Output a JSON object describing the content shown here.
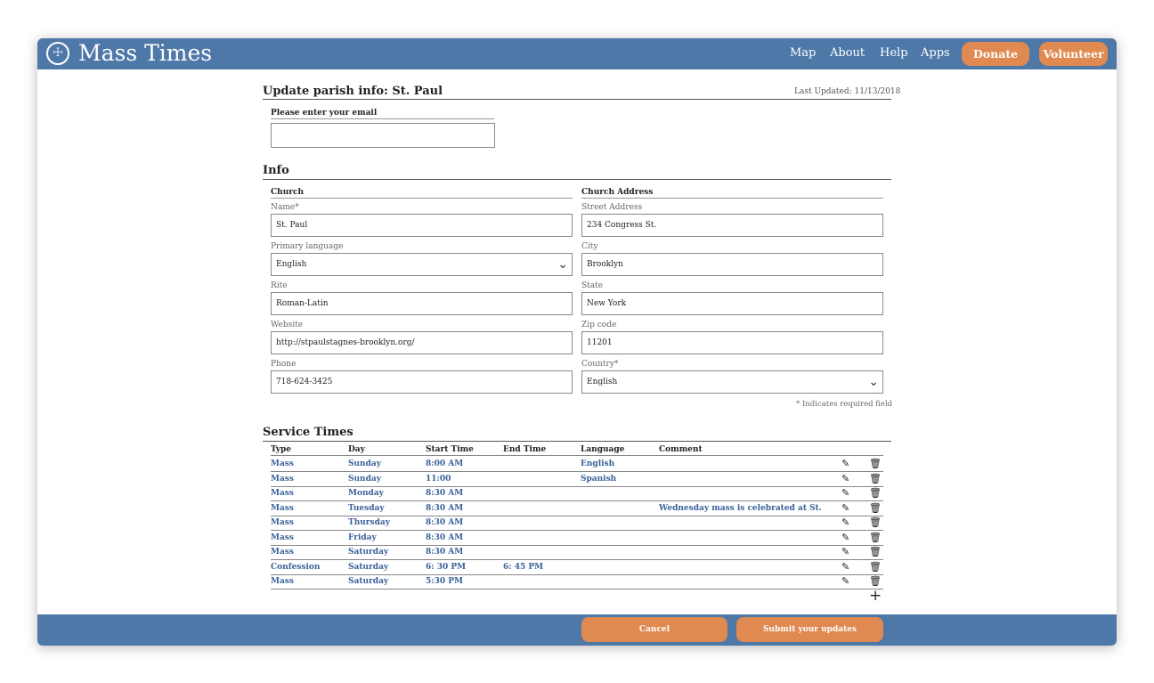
{
  "app": {
    "brand": "Mass Times",
    "logo_glyph": "☩",
    "nav": [
      "Map",
      "About",
      "Help",
      "Apps"
    ],
    "donate_label": "Donate",
    "volunteer_label": "Volunteer"
  },
  "page": {
    "title": "Update parish info: St. Paul",
    "last_updated": "Last Updated:  11/13/2018",
    "email_label": "Please enter your email",
    "email_value": ""
  },
  "info": {
    "heading": "Info",
    "church_heading": "Church",
    "address_heading": "Church Address",
    "name_label": "Name*",
    "name_value": "St. Paul",
    "language_label": "Primary language",
    "language_value": "English",
    "rite_label": "Rite",
    "rite_value": "Roman-Latin",
    "website_label": "Website",
    "website_value": "http://stpaulstagnes-brooklyn.org/",
    "phone_label": "Phone",
    "phone_value": "718-624-3425",
    "street_label": "Street Address",
    "street_value": "234 Congress St.",
    "city_label": "City",
    "city_value": "Brooklyn",
    "state_label": "State",
    "state_value": "New York",
    "zip_label": "Zip code",
    "zip_value": "11201",
    "country_label": "Country*",
    "country_value": "English",
    "required_note": "* Indicates required field"
  },
  "services": {
    "heading": "Service Times",
    "columns": [
      "Type",
      "Day",
      "Start Time",
      "End Time",
      "Language",
      "Comment"
    ],
    "rows": [
      {
        "type": "Mass",
        "day": "Sunday",
        "start": "8:00 AM",
        "end": "",
        "language": "English",
        "comment": ""
      },
      {
        "type": "Mass",
        "day": "Sunday",
        "start": "11:00",
        "end": "",
        "language": "Spanish",
        "comment": ""
      },
      {
        "type": "Mass",
        "day": "Monday",
        "start": "8:30 AM",
        "end": "",
        "language": "",
        "comment": ""
      },
      {
        "type": "Mass",
        "day": "Tuesday",
        "start": "8:30 AM",
        "end": "",
        "language": "",
        "comment": "Wednesday mass is celebrated at St."
      },
      {
        "type": "Mass",
        "day": "Thursday",
        "start": "8:30 AM",
        "end": "",
        "language": "",
        "comment": ""
      },
      {
        "type": "Mass",
        "day": "Friday",
        "start": "8:30 AM",
        "end": "",
        "language": "",
        "comment": ""
      },
      {
        "type": "Mass",
        "day": "Saturday",
        "start": "8:30 AM",
        "end": "",
        "language": "",
        "comment": ""
      },
      {
        "type": "Confession",
        "day": "Saturday",
        "start": "6: 30 PM",
        "end": "6: 45 PM",
        "language": "",
        "comment": ""
      },
      {
        "type": "Mass",
        "day": "Saturday",
        "start": "5:30 PM",
        "end": "",
        "language": "",
        "comment": ""
      }
    ],
    "edit_icon": "pencil-icon",
    "delete_icon": "trash-icon",
    "add_icon": "plus-icon"
  },
  "footer": {
    "cancel_label": "Cancel",
    "submit_label": "Submit your updates"
  },
  "colors": {
    "bar": "#4e78a8",
    "accent": "#e08a52",
    "link": "#3a6299"
  }
}
